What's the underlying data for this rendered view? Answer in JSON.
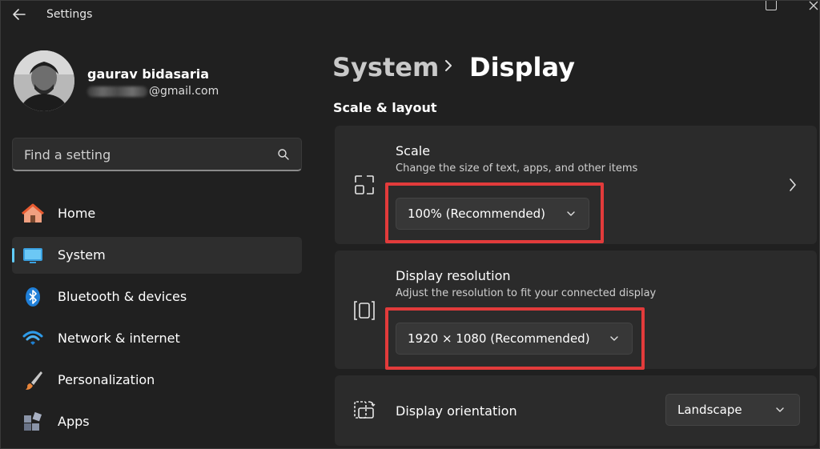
{
  "window": {
    "title": "Settings"
  },
  "profile": {
    "name": "gaurav bidasaria",
    "email_suffix": "@gmail.com"
  },
  "search": {
    "placeholder": "Find a setting"
  },
  "nav": [
    {
      "label": "Home",
      "icon": "home-icon",
      "active": false
    },
    {
      "label": "System",
      "icon": "monitor-icon",
      "active": true
    },
    {
      "label": "Bluetooth & devices",
      "icon": "bluetooth-icon",
      "active": false
    },
    {
      "label": "Network & internet",
      "icon": "wifi-icon",
      "active": false
    },
    {
      "label": "Personalization",
      "icon": "brush-icon",
      "active": false
    },
    {
      "label": "Apps",
      "icon": "apps-icon",
      "active": false
    }
  ],
  "breadcrumb": {
    "parent": "System",
    "current": "Display"
  },
  "section": {
    "title": "Scale & layout"
  },
  "cards": {
    "scale": {
      "title": "Scale",
      "subtitle": "Change the size of text, apps, and other items",
      "value": "100% (Recommended)"
    },
    "resolution": {
      "title": "Display resolution",
      "subtitle": "Adjust the resolution to fit your connected display",
      "value": "1920 × 1080 (Recommended)"
    },
    "orientation": {
      "title": "Display orientation",
      "value": "Landscape"
    }
  },
  "colors": {
    "accent": "#60cdff",
    "highlight": "#e23b3b",
    "background": "#202020",
    "card": "#2b2b2b"
  }
}
